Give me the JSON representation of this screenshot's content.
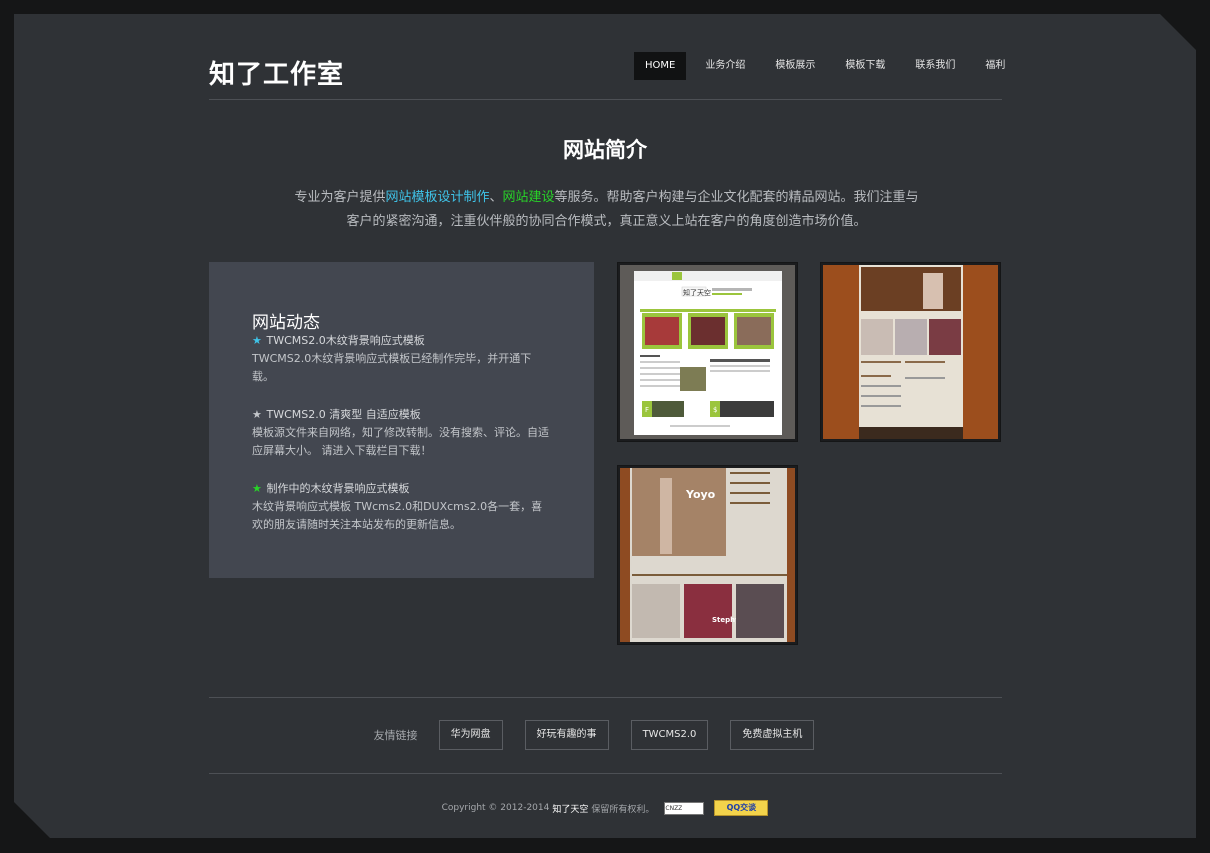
{
  "header": {
    "logo": "知了工作室",
    "nav": [
      "HOME",
      "业务介绍",
      "模板展示",
      "模板下载",
      "联系我们",
      "福利"
    ]
  },
  "intro": {
    "title": "网站简介",
    "line1_prefix": "专业为客户提供",
    "link1": "网站模板设计制作",
    "sep": "、",
    "link2": "网站建设",
    "line1_suffix": "等服务。帮助客户构建与企业文化配套的精品网站。我们注重与",
    "line2": "客户的紧密沟通，注重伙伴般的协同合作模式，真正意义上站在客户的角度创造市场价值。",
    "colors": {
      "link1": "#3fc3e8",
      "link2": "#28d428"
    }
  },
  "news": {
    "title": "网站动态",
    "items": [
      {
        "star_color": "#3fc3e8",
        "head": "TWCMS2.0木纹背景响应式模板",
        "body": "TWCMS2.0木纹背景响应式模板已经制作完毕，并开通下载。"
      },
      {
        "star_color": "#c3c6ca",
        "head": "TWCMS2.0 清爽型 自适应模板",
        "body": "模板源文件来自网络，知了修改转制。没有搜索、评论。自适应屏幕大小。 请进入下载栏目下载！"
      },
      {
        "star_color": "#28d428",
        "head": "制作中的木纹背景响应式模板",
        "body": "木纹背景响应式模板 TWcms2.0和DUXcms2.0各一套，喜欢的朋友请随时关注本站发布的更新信息。"
      }
    ]
  },
  "thumbs": {
    "t1": {
      "logo": "知了天空",
      "cards": [
        "F",
        "$"
      ]
    },
    "t2": {},
    "t3": {
      "caption": "Yoyo",
      "label": "Stephy"
    }
  },
  "friends": {
    "label": "友情链接",
    "links": [
      "华为网盘",
      "好玩有趣的事",
      "TWCMS2.0",
      "免费虚拟主机"
    ]
  },
  "footer": {
    "copyright": "Copyright © 2012-2014",
    "brand": "知了天空",
    "rights": "保留所有权利。",
    "cnzz": "CNZZ",
    "qq": "QQ交谈"
  }
}
